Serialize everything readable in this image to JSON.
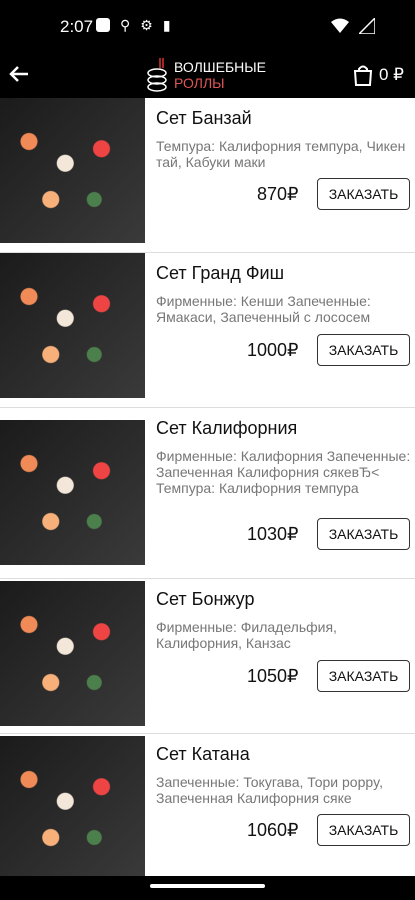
{
  "status": {
    "time": "2:07"
  },
  "header": {
    "logo_line1": "ВОЛШЕБНЫЕ",
    "logo_line2": "РОЛЛЫ",
    "cart_count": "0 ₽"
  },
  "items": [
    {
      "title": "Сет Банзай",
      "desc": "Темпура: Калифорния темпура, Чикен тай, Кабуки маки",
      "price": "870₽",
      "button": "ЗАКАЗАТЬ"
    },
    {
      "title": "Сет Гранд Фиш",
      "desc": "Фирменные: Кенши Запеченные: Ямакаси, Запеченный с лососем",
      "price": "1000₽",
      "button": "ЗАКАЗАТЬ"
    },
    {
      "title": "Сет Калифорния",
      "desc": "Фирменные: Калифорния Запеченные: Запеченная Калифорния сякевЂ< Темпура: Калифорния темпура",
      "price": "1030₽",
      "button": "ЗАКАЗАТЬ"
    },
    {
      "title": "Сет Бонжур",
      "desc": "Фирменные: Филадельфия, Калифорния, Канзас",
      "price": "1050₽",
      "button": "ЗАКАЗАТЬ"
    },
    {
      "title": "Сет Катана",
      "desc": "Запеченные: Токугава, Тори роррy, Запеченная Калифорния сяке",
      "price": "1060₽",
      "button": "ЗАКАЗАТЬ"
    }
  ]
}
